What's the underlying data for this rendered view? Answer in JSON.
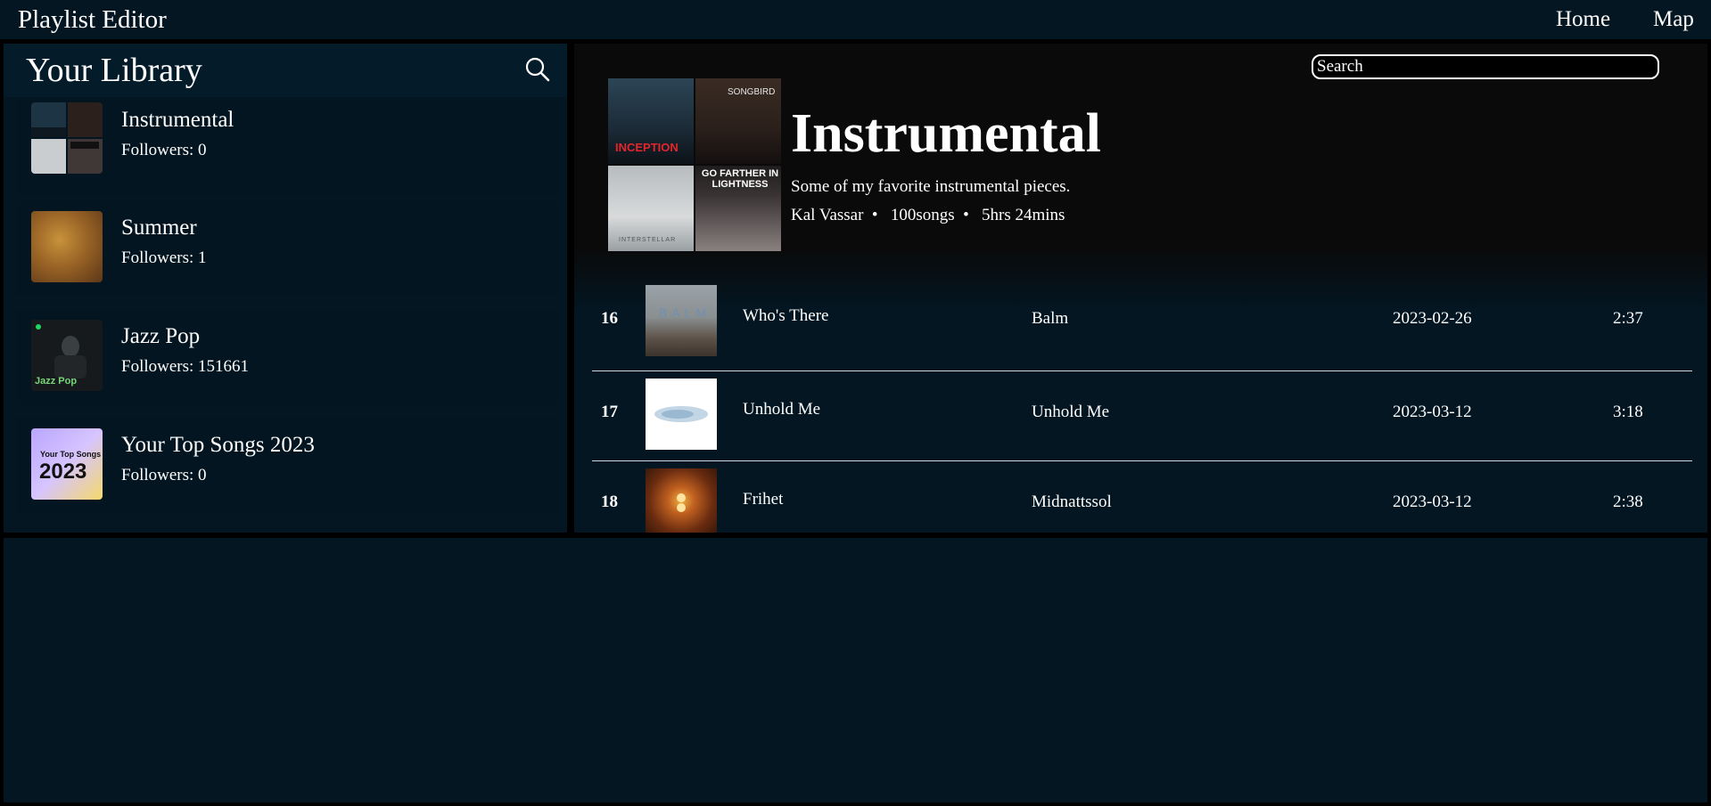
{
  "app": {
    "title": "Playlist Editor"
  },
  "nav": {
    "home": "Home",
    "map": "Map"
  },
  "library": {
    "title": "Your Library",
    "items": [
      {
        "name": "Instrumental",
        "followers": "Followers: 0",
        "thumb": "instrumental-collage"
      },
      {
        "name": "Summer",
        "followers": "Followers: 1",
        "thumb": "summer-texture"
      },
      {
        "name": "Jazz Pop",
        "followers": "Followers: 151661",
        "thumb": "jazz-pop-cover",
        "thumb_text": "Jazz Pop"
      },
      {
        "name": "Your Top Songs 2023",
        "followers": "Followers: 0",
        "thumb": "top-songs-cover",
        "thumb_text": "Your Top Songs",
        "thumb_year": "2023"
      }
    ]
  },
  "playlist": {
    "search_placeholder": "Search",
    "title": "Instrumental",
    "description": "Some of my favorite instrumental pieces.",
    "meta": "Kal Vassar  •   100songs  •   5hrs 24mins",
    "covers": [
      {
        "label": "INCEPTION",
        "color": "#1b2a36"
      },
      {
        "label": "SONGBIRD",
        "color": "#2a1f1a"
      },
      {
        "label": "INTERSTELLAR",
        "color": "#c8ccce"
      },
      {
        "label": "GO FARTHER IN LIGHTNESS",
        "color": "#3a3434"
      }
    ]
  },
  "tracks": [
    {
      "num": "16",
      "title": "Who's There",
      "album": "Balm",
      "date": "2023-02-26",
      "duration": "2:37",
      "art_text": "BALM"
    },
    {
      "num": "17",
      "title": "Unhold Me",
      "album": "Unhold Me",
      "date": "2023-03-12",
      "duration": "3:18"
    },
    {
      "num": "18",
      "title": "Frihet",
      "album": "Midnattssol",
      "date": "2023-03-12",
      "duration": "2:38"
    }
  ],
  "colors": {
    "panel": "#031622",
    "background": "#000000",
    "text": "#ffffff"
  }
}
